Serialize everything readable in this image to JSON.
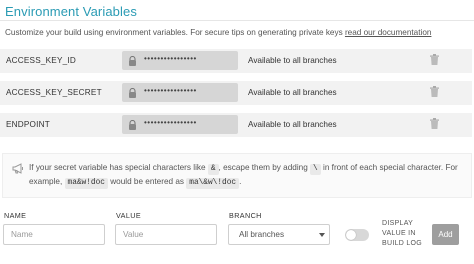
{
  "section": {
    "title": "Environment Variables",
    "intro_text": "Customize your build using environment variables. For secure tips on generating private keys ",
    "intro_link": "read our documentation"
  },
  "variables": [
    {
      "name": "ACCESS_KEY_ID",
      "value_masked": "••••••••••••••••",
      "branch": "Available to all branches"
    },
    {
      "name": "ACCESS_KEY_SECRET",
      "value_masked": "••••••••••••••••",
      "branch": "Available to all branches"
    },
    {
      "name": "ENDPOINT",
      "value_masked": "••••••••••••••••",
      "branch": "Available to all branches"
    }
  ],
  "note": {
    "line1_a": "If your secret variable has special characters like",
    "code_amp": "&",
    "line1_b": ", escape them by adding",
    "code_backslash": "\\",
    "line1_c": "in front of each special character. For",
    "line2_a": "example,",
    "code_example": "ma&w!doc",
    "line2_b": "would be entered as",
    "code_escaped": "ma\\&w\\!doc",
    "line2_c": "."
  },
  "form": {
    "name_header": "NAME",
    "value_header": "VALUE",
    "branch_header": "BRANCH",
    "name_placeholder": "Name",
    "value_placeholder": "Value",
    "branch_selected": "All branches",
    "display_label_1": "DISPLAY",
    "display_label_2": "VALUE IN",
    "display_label_3": "BUILD LOG",
    "display_toggle_on": false,
    "add_label": "Add"
  },
  "colors": {
    "title": "#2a9bb4",
    "row_bg": "#f2f2f2",
    "masked_bg": "#d6d6d6",
    "add_button": "#9e9e9e"
  }
}
